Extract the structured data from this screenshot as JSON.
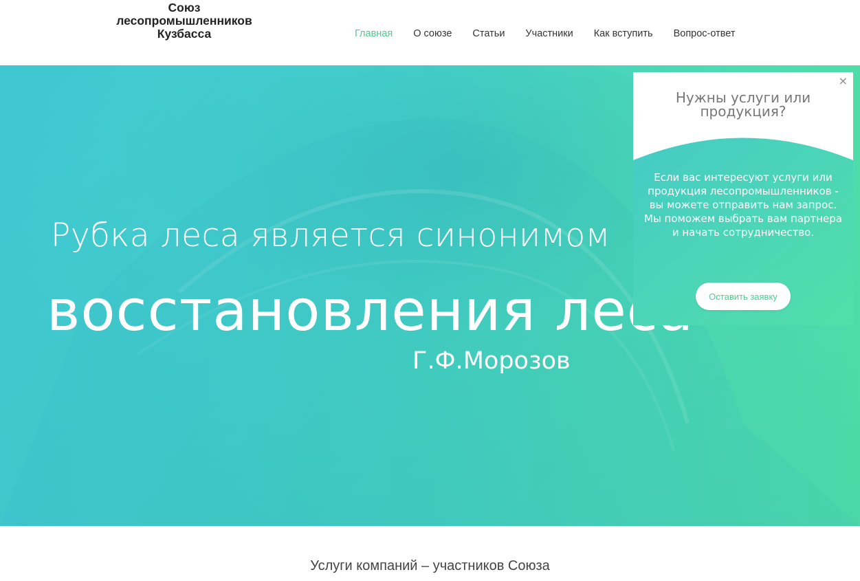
{
  "logo": {
    "line1": "Союз",
    "line2": "лесопромышленников",
    "line3": "Кузбасса"
  },
  "nav": {
    "items": [
      {
        "label": "Главная",
        "active": true
      },
      {
        "label": "О союзе",
        "active": false
      },
      {
        "label": "Статьи",
        "active": false
      },
      {
        "label": "Участники",
        "active": false
      },
      {
        "label": "Как вступить",
        "active": false
      },
      {
        "label": "Вопрос-ответ",
        "active": false
      }
    ]
  },
  "hero": {
    "line1": "Рубка леса является синонимом",
    "line2": "восстановления леса",
    "author": "Г.Ф.Морозов"
  },
  "popup": {
    "close": "×",
    "title_line1": "Нужны услуги или",
    "title_line2": "продукция?",
    "text": "Если вас интересуют услуги или продукция лесопромышленников - вы можете отправить нам запрос. Мы поможем выбрать вам партнера и начать сотрудничество.",
    "button": "Оставить заявку"
  },
  "section": {
    "title": "Услуги компаний – участников Союза"
  },
  "colors": {
    "accent": "#4fcb92",
    "hero_start": "#3fc7d2",
    "hero_end": "#52e0a5"
  }
}
